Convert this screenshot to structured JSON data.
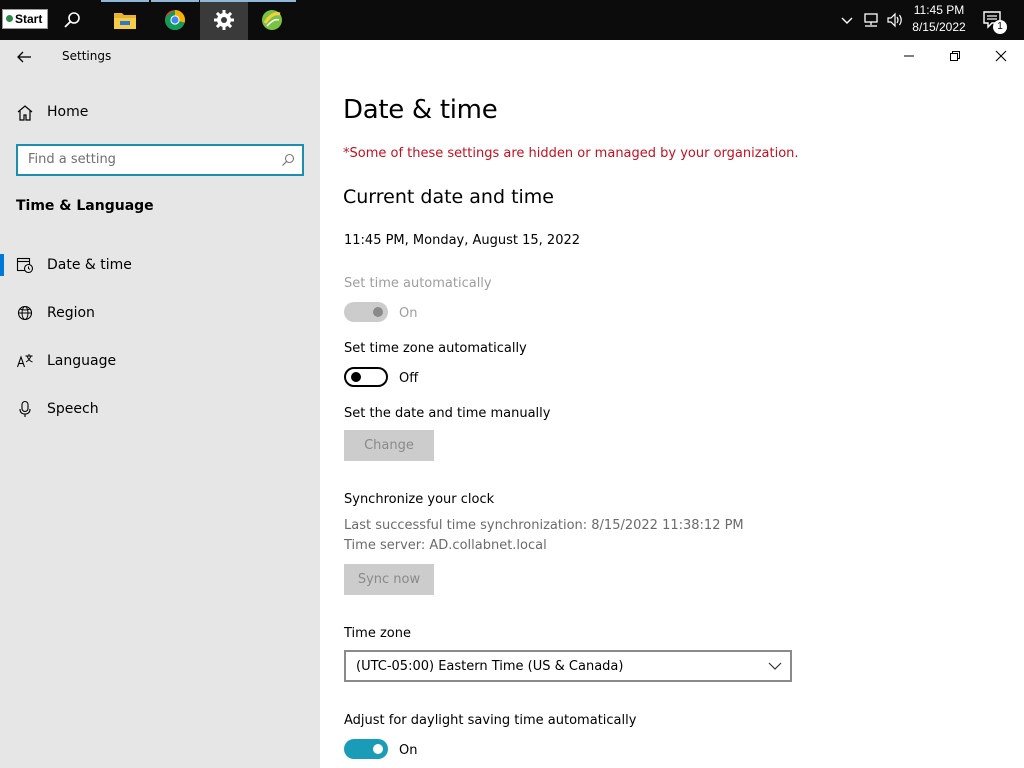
{
  "taskbar": {
    "start_label": "Start",
    "apps": [
      {
        "name": "search-icon"
      },
      {
        "name": "file-explorer-icon"
      },
      {
        "name": "chrome-icon"
      },
      {
        "name": "settings-gear-icon"
      },
      {
        "name": "green-app-icon"
      }
    ],
    "clock_time": "11:45 PM",
    "clock_date": "8/15/2022",
    "notification_count": "1"
  },
  "window": {
    "app_title": "Settings"
  },
  "sidebar": {
    "home_label": "Home",
    "search_placeholder": "Find a setting",
    "section_title": "Time & Language",
    "items": [
      {
        "label": "Date & time",
        "icon": "calendar-clock-icon",
        "selected": true
      },
      {
        "label": "Region",
        "icon": "globe-icon",
        "selected": false
      },
      {
        "label": "Language",
        "icon": "language-icon",
        "selected": false
      },
      {
        "label": "Speech",
        "icon": "microphone-icon",
        "selected": false
      }
    ]
  },
  "main": {
    "title": "Date & time",
    "warning": "*Some of these settings are hidden or managed by your organization.",
    "current_heading": "Current date and time",
    "current_value": "11:45 PM, Monday, August 15, 2022",
    "set_time_auto": {
      "label": "Set time automatically",
      "state": "On"
    },
    "set_tz_auto": {
      "label": "Set time zone automatically",
      "state": "Off"
    },
    "manual": {
      "label": "Set the date and time manually",
      "button": "Change"
    },
    "sync": {
      "heading": "Synchronize your clock",
      "last_sync": "Last successful time synchronization: 8/15/2022 11:38:12 PM",
      "server": "Time server: AD.collabnet.local",
      "button": "Sync now"
    },
    "timezone": {
      "label": "Time zone",
      "value": "(UTC-05:00) Eastern Time (US & Canada)"
    },
    "dst": {
      "label": "Adjust for daylight saving time automatically",
      "state": "On"
    }
  },
  "colors": {
    "accent": "#1a9bb8",
    "warning": "#c50f1f",
    "sidebar_bg": "#e6e6e6"
  }
}
